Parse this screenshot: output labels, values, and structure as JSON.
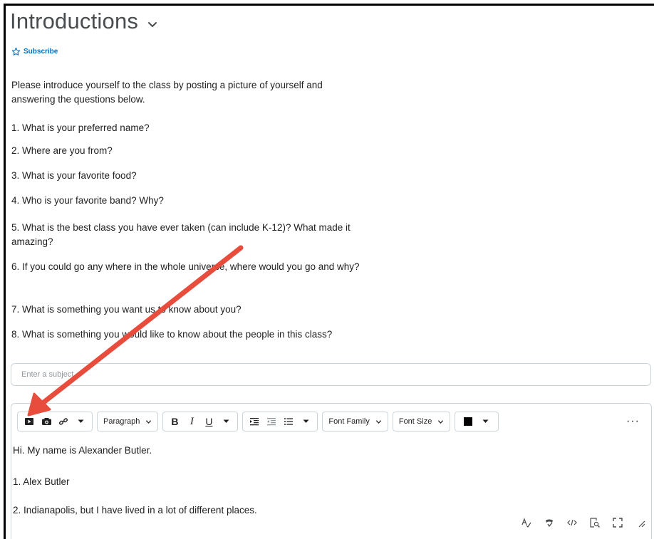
{
  "page": {
    "title": "Introductions",
    "subscribe_label": "Subscribe"
  },
  "prompt": {
    "intro": "Please introduce yourself to the class by posting a picture of yourself and answering the questions below.",
    "questions": [
      "1. What is your preferred name?",
      "2. Where are you from?",
      "3. What is your favorite food?",
      "4. Who is your favorite band? Why?",
      "5. What is the best class you have ever taken (can include K-12)? What made it amazing?",
      "6. If you could go any where in the whole universe, where would you go and why?",
      "7. What is something you want us to know about you?",
      "8. What is something you would like to know about the people in this class?"
    ]
  },
  "subject": {
    "placeholder": "Enter a subject"
  },
  "toolbar": {
    "insert_stuff_icon": "video-play-icon",
    "insert_image_icon": "camera-icon",
    "insert_link_icon": "link-icon",
    "paragraph_label": "Paragraph",
    "bold_label": "B",
    "italic_label": "I",
    "underline_label": "U",
    "font_family_label": "Font Family",
    "font_size_label": "Font Size",
    "text_color": "#000000",
    "more_label": "···"
  },
  "editor": {
    "lines": [
      "Hi. My name is Alexander Butler.",
      "1. Alex Butler",
      "2. Indianapolis, but I have lived in a lot of different places."
    ]
  },
  "colors": {
    "accent": "#006fbf",
    "annotation_arrow": "#e74c3c"
  }
}
